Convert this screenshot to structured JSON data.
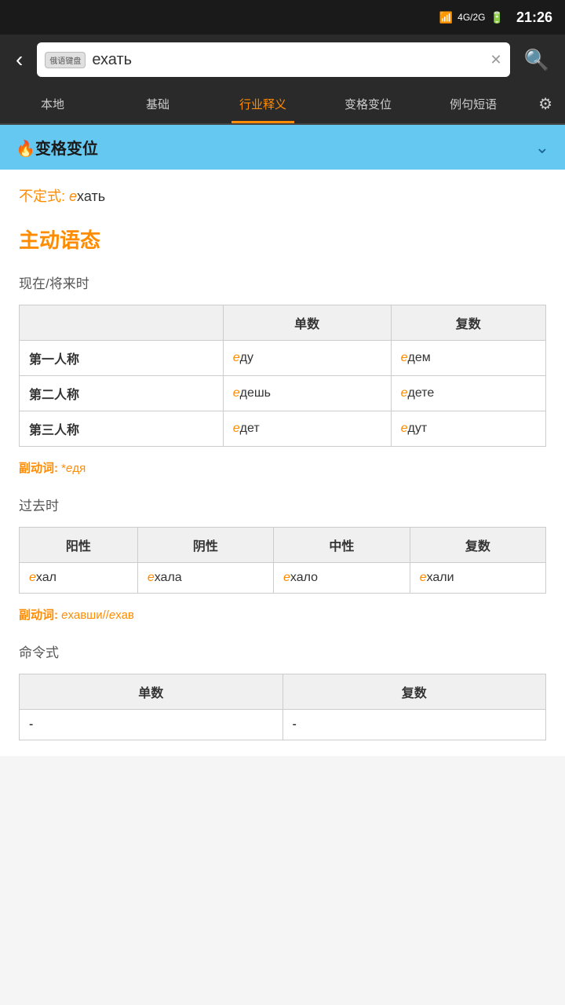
{
  "status": {
    "time": "21:26",
    "signal": "📶",
    "network": "4G/2G",
    "battery": "🔋"
  },
  "search": {
    "keyboard_badge": "俄语键盘",
    "query": "ехать",
    "placeholder": "ехать"
  },
  "nav": {
    "back": "‹",
    "tabs": [
      {
        "id": "local",
        "label": "本地"
      },
      {
        "id": "basic",
        "label": "基础"
      },
      {
        "id": "industry",
        "label": "行业释义",
        "active": true
      },
      {
        "id": "conjugation",
        "label": "变格变位"
      },
      {
        "id": "examples",
        "label": "例句短语"
      }
    ],
    "settings_label": "⚙"
  },
  "section_header": {
    "title": "🔥变格变位",
    "icon": "⌄"
  },
  "infinitive": {
    "label": "不定式:",
    "e_highlight": "е",
    "rest": "хать"
  },
  "voice": {
    "title": "主动语态"
  },
  "present_tense": {
    "label": "现在/将来时",
    "headers": [
      "",
      "单数",
      "复数"
    ],
    "rows": [
      {
        "person": "第一人称",
        "singular_e": "е",
        "singular_rest": "ду",
        "plural_e": "е",
        "plural_rest": "дем"
      },
      {
        "person": "第二人称",
        "singular_e": "е",
        "singular_rest": "дешь",
        "plural_e": "е",
        "plural_rest": "дете"
      },
      {
        "person": "第三人称",
        "singular_e": "е",
        "singular_rest": "дет",
        "plural_e": "е",
        "plural_rest": "дут"
      }
    ]
  },
  "present_participle": {
    "label": "副动词:",
    "prefix": "*",
    "e_highlight": "е",
    "rest": "дя"
  },
  "past_tense": {
    "label": "过去时",
    "headers": [
      "阳性",
      "阴性",
      "中性",
      "复数"
    ],
    "row": [
      {
        "e": "е",
        "rest": "хал"
      },
      {
        "e": "е",
        "rest": "хала"
      },
      {
        "e": "е",
        "rest": "хало"
      },
      {
        "e": "е",
        "rest": "хали"
      }
    ]
  },
  "past_participle": {
    "label": "副动词:",
    "e1": "е",
    "rest1": "хавши//",
    "e2": "е",
    "rest2": "хав"
  },
  "imperative": {
    "label": "命令式",
    "headers": [
      "单数",
      "复数"
    ],
    "rows": [
      {
        "singular": "-",
        "plural": "-"
      }
    ]
  }
}
